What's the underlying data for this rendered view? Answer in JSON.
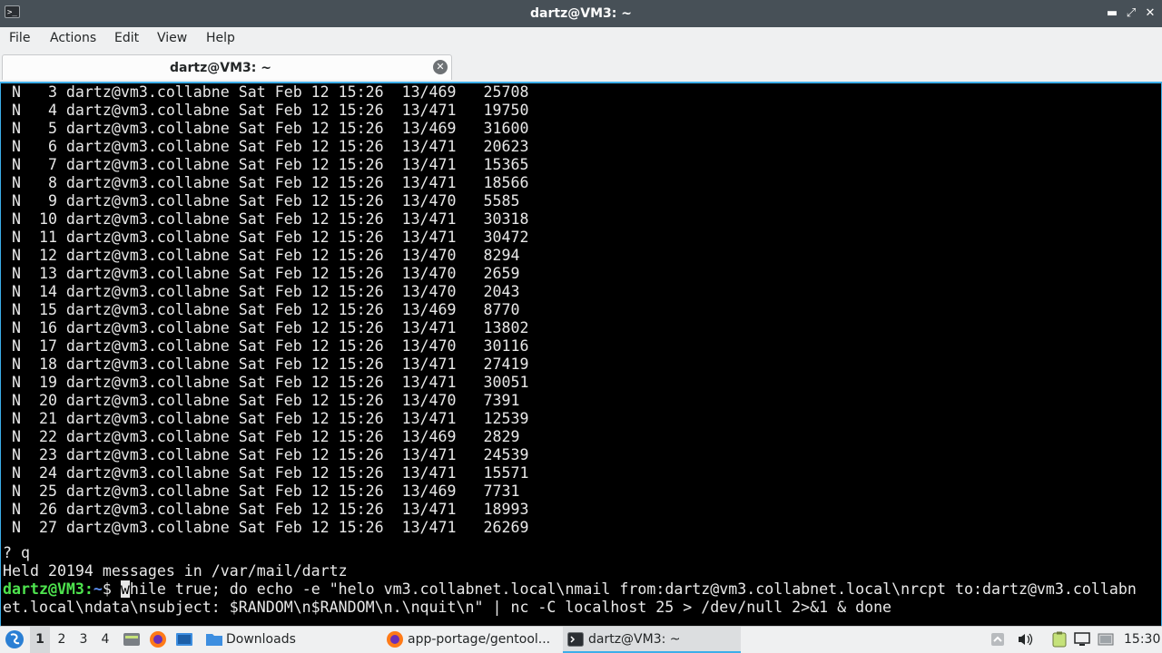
{
  "window": {
    "title": "dartz@VM3: ~",
    "minimize_glyph": "▬",
    "maximize_glyph": "⤢",
    "close_glyph": "✕"
  },
  "menu": {
    "file": "File",
    "actions": "Actions",
    "edit": "Edit",
    "view": "View",
    "help": "Help"
  },
  "tab": {
    "label": "dartz@VM3: ~",
    "close_glyph": "✕"
  },
  "terminal": {
    "mail_rows": [
      {
        "flag": "N",
        "num": "3",
        "from": "dartz@vm3.collabne",
        "date": "Sat Feb 12 15:26",
        "lines": "13/469",
        "id": "25708"
      },
      {
        "flag": "N",
        "num": "4",
        "from": "dartz@vm3.collabne",
        "date": "Sat Feb 12 15:26",
        "lines": "13/471",
        "id": "19750"
      },
      {
        "flag": "N",
        "num": "5",
        "from": "dartz@vm3.collabne",
        "date": "Sat Feb 12 15:26",
        "lines": "13/469",
        "id": "31600"
      },
      {
        "flag": "N",
        "num": "6",
        "from": "dartz@vm3.collabne",
        "date": "Sat Feb 12 15:26",
        "lines": "13/471",
        "id": "20623"
      },
      {
        "flag": "N",
        "num": "7",
        "from": "dartz@vm3.collabne",
        "date": "Sat Feb 12 15:26",
        "lines": "13/471",
        "id": "15365"
      },
      {
        "flag": "N",
        "num": "8",
        "from": "dartz@vm3.collabne",
        "date": "Sat Feb 12 15:26",
        "lines": "13/471",
        "id": "18566"
      },
      {
        "flag": "N",
        "num": "9",
        "from": "dartz@vm3.collabne",
        "date": "Sat Feb 12 15:26",
        "lines": "13/470",
        "id": "5585"
      },
      {
        "flag": "N",
        "num": "10",
        "from": "dartz@vm3.collabne",
        "date": "Sat Feb 12 15:26",
        "lines": "13/471",
        "id": "30318"
      },
      {
        "flag": "N",
        "num": "11",
        "from": "dartz@vm3.collabne",
        "date": "Sat Feb 12 15:26",
        "lines": "13/471",
        "id": "30472"
      },
      {
        "flag": "N",
        "num": "12",
        "from": "dartz@vm3.collabne",
        "date": "Sat Feb 12 15:26",
        "lines": "13/470",
        "id": "8294"
      },
      {
        "flag": "N",
        "num": "13",
        "from": "dartz@vm3.collabne",
        "date": "Sat Feb 12 15:26",
        "lines": "13/470",
        "id": "2659"
      },
      {
        "flag": "N",
        "num": "14",
        "from": "dartz@vm3.collabne",
        "date": "Sat Feb 12 15:26",
        "lines": "13/470",
        "id": "2043"
      },
      {
        "flag": "N",
        "num": "15",
        "from": "dartz@vm3.collabne",
        "date": "Sat Feb 12 15:26",
        "lines": "13/469",
        "id": "8770"
      },
      {
        "flag": "N",
        "num": "16",
        "from": "dartz@vm3.collabne",
        "date": "Sat Feb 12 15:26",
        "lines": "13/471",
        "id": "13802"
      },
      {
        "flag": "N",
        "num": "17",
        "from": "dartz@vm3.collabne",
        "date": "Sat Feb 12 15:26",
        "lines": "13/470",
        "id": "30116"
      },
      {
        "flag": "N",
        "num": "18",
        "from": "dartz@vm3.collabne",
        "date": "Sat Feb 12 15:26",
        "lines": "13/471",
        "id": "27419"
      },
      {
        "flag": "N",
        "num": "19",
        "from": "dartz@vm3.collabne",
        "date": "Sat Feb 12 15:26",
        "lines": "13/471",
        "id": "30051"
      },
      {
        "flag": "N",
        "num": "20",
        "from": "dartz@vm3.collabne",
        "date": "Sat Feb 12 15:26",
        "lines": "13/470",
        "id": "7391"
      },
      {
        "flag": "N",
        "num": "21",
        "from": "dartz@vm3.collabne",
        "date": "Sat Feb 12 15:26",
        "lines": "13/471",
        "id": "12539"
      },
      {
        "flag": "N",
        "num": "22",
        "from": "dartz@vm3.collabne",
        "date": "Sat Feb 12 15:26",
        "lines": "13/469",
        "id": "2829"
      },
      {
        "flag": "N",
        "num": "23",
        "from": "dartz@vm3.collabne",
        "date": "Sat Feb 12 15:26",
        "lines": "13/471",
        "id": "24539"
      },
      {
        "flag": "N",
        "num": "24",
        "from": "dartz@vm3.collabne",
        "date": "Sat Feb 12 15:26",
        "lines": "13/471",
        "id": "15571"
      },
      {
        "flag": "N",
        "num": "25",
        "from": "dartz@vm3.collabne",
        "date": "Sat Feb 12 15:26",
        "lines": "13/469",
        "id": "7731"
      },
      {
        "flag": "N",
        "num": "26",
        "from": "dartz@vm3.collabne",
        "date": "Sat Feb 12 15:26",
        "lines": "13/471",
        "id": "18993"
      },
      {
        "flag": "N",
        "num": "27",
        "from": "dartz@vm3.collabne",
        "date": "Sat Feb 12 15:26",
        "lines": "13/471",
        "id": "26269"
      }
    ],
    "quit_line": "? q",
    "held_line": "Held 20194 messages in /var/mail/dartz",
    "prompt_user": "dartz@VM3",
    "prompt_colon": ":",
    "prompt_path": "~",
    "prompt_dollar": "$ ",
    "cursor_char": "w",
    "command_rest": "hile true; do echo -e \"helo vm3.collabnet.local\\nmail from:dartz@vm3.collabnet.local\\nrcpt to:dartz@vm3.collabn",
    "command_wrap": "et.local\\ndata\\nsubject: $RANDOM\\n$RANDOM\\n.\\nquit\\n\" | nc -C localhost 25 > /dev/null 2>&1 & done"
  },
  "taskbar": {
    "workspaces": [
      "1",
      "2",
      "3",
      "4"
    ],
    "active_workspace": "1",
    "downloads_label": "Downloads",
    "tasks": [
      {
        "label": "app-portage/gentool...",
        "icon": "firefox-icon"
      },
      {
        "label": "dartz@VM3: ~",
        "icon": "terminal-icon"
      }
    ],
    "clock": "15:30",
    "accent_color": "#3daee9"
  }
}
